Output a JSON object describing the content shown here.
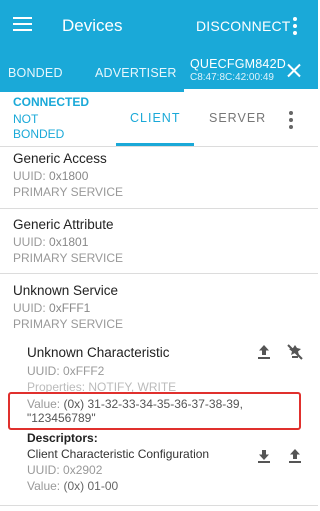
{
  "appbar": {
    "title": "Devices",
    "disconnect_label": "DISCONNECT"
  },
  "tabs": {
    "bonded": "BONDED",
    "advertiser": "ADVERTISER",
    "device_name": "QUECFGM842D",
    "device_mac": "C8:47:8C:42:00:49"
  },
  "status": {
    "connected": "CONNECTED",
    "bond_state": "NOT BONDED",
    "client_tab": "CLIENT",
    "server_tab": "SERVER"
  },
  "services": [
    {
      "name": "Generic Access",
      "uuid_label": "UUID:",
      "uuid": "0x1800",
      "type": "PRIMARY SERVICE"
    },
    {
      "name": "Generic Attribute",
      "uuid_label": "UUID:",
      "uuid": "0x1801",
      "type": "PRIMARY SERVICE"
    },
    {
      "name": "Unknown Service",
      "uuid_label": "UUID:",
      "uuid": "0xFFF1",
      "type": "PRIMARY SERVICE"
    }
  ],
  "characteristic": {
    "name": "Unknown Characteristic",
    "uuid_label": "UUID:",
    "uuid": "0xFFF2",
    "properties_label": "Properties:",
    "properties": "NOTIFY, WRITE",
    "value_label": "Value:",
    "value_line1": "(0x) 31-32-33-34-35-36-37-38-39,",
    "value_line2": "\"123456789\""
  },
  "descriptors": {
    "heading": "Descriptors:",
    "name": "Client Characteristic Configuration",
    "uuid_label": "UUID:",
    "uuid": "0x2902",
    "value_label": "Value:",
    "value": "(0x) 01-00"
  },
  "icons": {
    "menu": "hamburger-icon",
    "overflow": "more-vert-icon",
    "close": "close-icon",
    "read": "download-icon",
    "write": "upload-icon",
    "notify_off": "notifications-off-icon"
  },
  "colors": {
    "primary": "#1aa9d8",
    "highlight": "#e0302d"
  }
}
